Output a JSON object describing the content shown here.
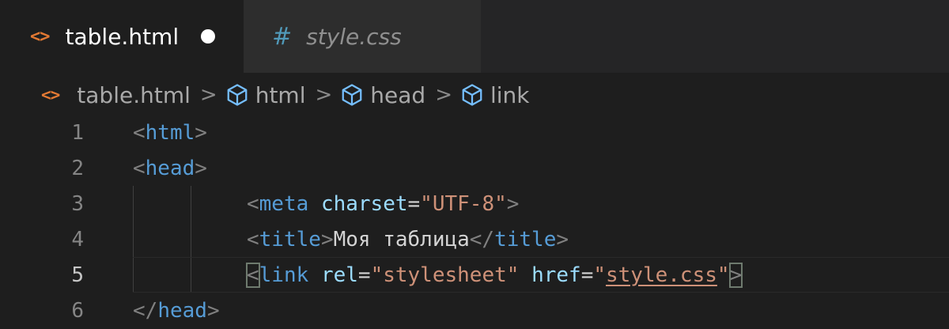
{
  "tabs": [
    {
      "label": "table.html",
      "icon": "html-icon",
      "active": true,
      "dirty": true
    },
    {
      "label": "style.css",
      "icon": "css-icon",
      "active": false
    }
  ],
  "breadcrumb": {
    "file_icon": "<>",
    "css_icon": "#",
    "items": [
      "table.html",
      "html",
      "head",
      "link"
    ],
    "separator": ">"
  },
  "editor": {
    "current_line": 5,
    "lines": [
      {
        "n": "1",
        "parts": [
          [
            "tag",
            "<"
          ],
          [
            "tname",
            "html"
          ],
          [
            "tag",
            ">"
          ]
        ]
      },
      {
        "n": "2",
        "parts": [
          [
            "tag",
            "<"
          ],
          [
            "tname",
            "head"
          ],
          [
            "tag",
            ">"
          ]
        ]
      },
      {
        "n": "3",
        "parts": [
          [
            "tag",
            "<"
          ],
          [
            "tname",
            "meta"
          ],
          [
            "txt",
            " "
          ],
          [
            "attr",
            "charset"
          ],
          [
            "txt",
            "="
          ],
          [
            "str",
            "\"UTF-8\""
          ],
          [
            "tag",
            ">"
          ]
        ]
      },
      {
        "n": "4",
        "parts": [
          [
            "tag",
            "<"
          ],
          [
            "tname",
            "title"
          ],
          [
            "tag",
            ">"
          ],
          [
            "txt",
            "Моя таблица"
          ],
          [
            "tag",
            "</"
          ],
          [
            "tname",
            "title"
          ],
          [
            "tag",
            ">"
          ]
        ]
      },
      {
        "n": "5",
        "parts": [
          [
            "tag",
            "<"
          ],
          [
            "tname",
            "link"
          ],
          [
            "txt",
            " "
          ],
          [
            "attr",
            "rel"
          ],
          [
            "txt",
            "="
          ],
          [
            "str",
            "\"stylesheet\""
          ],
          [
            "txt",
            " "
          ],
          [
            "attr",
            "href"
          ],
          [
            "txt",
            "="
          ],
          [
            "str",
            "\""
          ],
          [
            "str",
            "style.css"
          ],
          [
            "str",
            "\""
          ],
          [
            "tag",
            ">"
          ]
        ]
      },
      {
        "n": "6",
        "parts": [
          [
            "tag",
            "</"
          ],
          [
            "tname",
            "head"
          ],
          [
            "tag",
            ">"
          ]
        ]
      }
    ]
  },
  "colors": {
    "background": "#1e1e1e",
    "tag": "#808080",
    "tag_name": "#569cd6",
    "attribute": "#9cdcfe",
    "string": "#ce9178",
    "html_icon": "#e37933",
    "css_icon": "#519aba"
  }
}
